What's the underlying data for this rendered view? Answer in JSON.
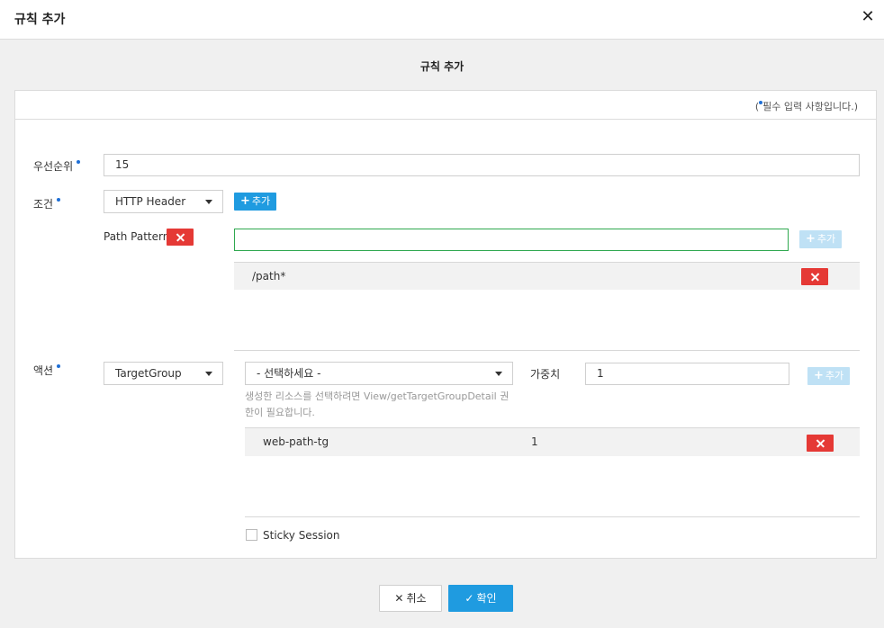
{
  "header": {
    "title": "규칙 추가",
    "close_icon": "close-icon"
  },
  "subtitle": "규칙 추가",
  "required_note": {
    "open": "(",
    "text": "필수 입력 사항입니다.)"
  },
  "priority": {
    "label": "우선순위",
    "value": "15"
  },
  "condition": {
    "label": "조건",
    "type_value": "HTTP Header",
    "add_label": "추가",
    "path_pattern_label": "Path Pattern",
    "path_input_value": "",
    "path_add_label": "추가",
    "paths": [
      {
        "value": "/path*"
      }
    ]
  },
  "action": {
    "label": "액션",
    "type_value": "TargetGroup",
    "target_select_value": "- 선택하세요 -",
    "weight_label": "가중치",
    "weight_value": "1",
    "add_label": "추가",
    "hint_line1": "생성한 리소스를 선택하려면 View/getTargetGroupDetail 권",
    "hint_line2": "한이 필요합니다.",
    "targets": [
      {
        "name": "web-path-tg",
        "weight": "1"
      }
    ],
    "sticky_session_label": "Sticky Session",
    "sticky_session_checked": false
  },
  "footer": {
    "cancel_label": "취소",
    "ok_label": "확인"
  },
  "colors": {
    "accent": "#1f9be0",
    "danger": "#e53935",
    "required_dot": "#1f6fd6",
    "focus_border": "#2fa84f"
  }
}
